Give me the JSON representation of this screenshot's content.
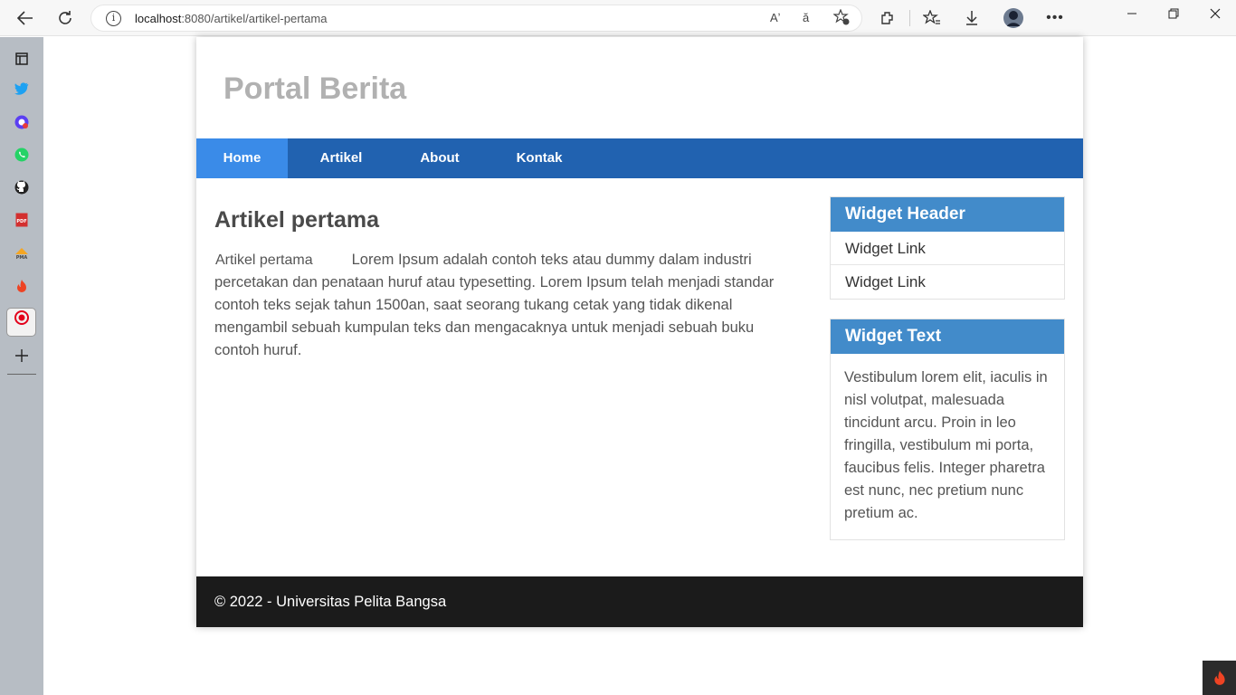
{
  "browser": {
    "url_host": "localhost",
    "url_path": ":8080/artikel/artikel-pertama",
    "info_glyph": "i",
    "read_aloud_glyph": "Aʼ",
    "translate_glyph": "ă"
  },
  "site": {
    "title": "Portal Berita"
  },
  "nav": {
    "items": [
      {
        "label": "Home"
      },
      {
        "label": "Artikel"
      },
      {
        "label": "About"
      },
      {
        "label": "Kontak"
      }
    ]
  },
  "article": {
    "title": "Artikel pertama",
    "image_alt": "Artikel pertama",
    "body": "Lorem Ipsum adalah contoh teks atau dummy dalam industri percetakan dan penataan huruf atau typesetting. Lorem Ipsum telah menjadi standar contoh teks sejak tahun 1500an, saat seorang tukang cetak yang tidak dikenal mengambil sebuah kumpulan teks dan mengacaknya untuk menjadi sebuah buku contoh huruf."
  },
  "widgets": {
    "header": {
      "title": "Widget Header",
      "links": [
        "Widget Link",
        "Widget Link"
      ]
    },
    "text": {
      "title": "Widget Text",
      "content": "Vestibulum lorem elit, iaculis in nisl volutpat, malesuada tincidunt arcu. Proin in leo fringilla, vestibulum mi porta, faucibus felis. Integer pharetra est nunc, nec pretium nunc pretium ac."
    }
  },
  "footer": {
    "text": "© 2022 - Universitas Pelita Bangsa"
  },
  "colors": {
    "nav_bg": "#2162b0",
    "nav_active": "#3a8be8",
    "widget_header": "#428bca",
    "footer_bg": "#1b1b1b",
    "title_gray": "#b1b1b1"
  }
}
